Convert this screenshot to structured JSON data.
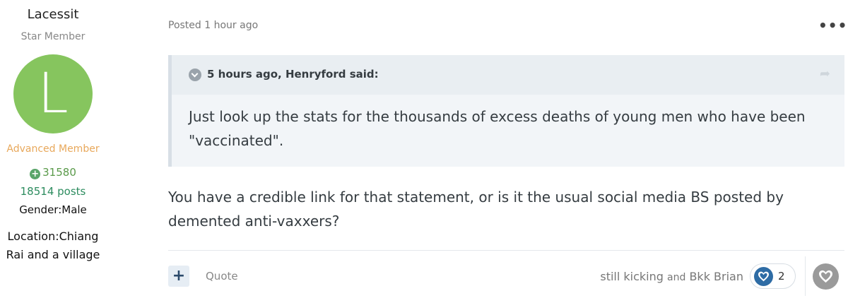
{
  "author": {
    "name": "Lacessit",
    "title": "Star Member",
    "avatar_letter": "L",
    "avatar_color": "#86c55e",
    "rank": "Advanced Member",
    "reputation": "31580",
    "posts": "18514 posts",
    "gender": "Gender:Male",
    "location": "Location:Chiang Rai and a village"
  },
  "post": {
    "posted": "Posted 1 hour ago",
    "more_icon": "•••",
    "quote": {
      "citation": "5 hours ago, Henryford said:",
      "text": "Just look up the stats for the thousands of excess deaths of young men who have been \"vaccinated\"."
    },
    "text": "You have a credible link for that statement, or is it the usual social media BS posted by demented anti-vaxxers?"
  },
  "footer": {
    "multiquote_label": "+",
    "quote_label": "Quote",
    "reactor_1": "still kicking",
    "reactor_and": "and",
    "reactor_2": "Bkk Brian",
    "reaction_count": "2",
    "reaction_color": "#2e6ca5"
  }
}
